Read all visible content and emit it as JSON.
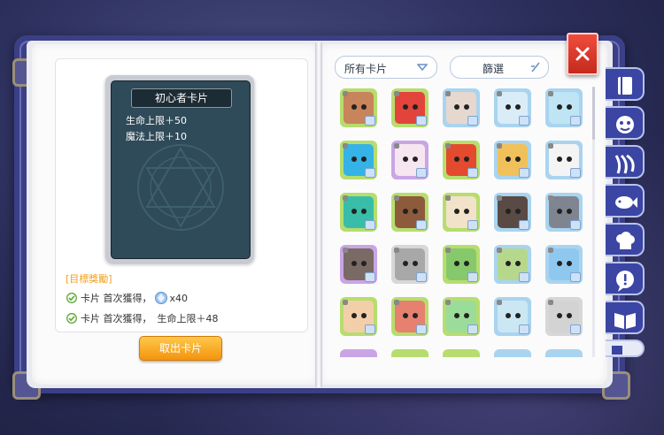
{
  "card": {
    "title": "初心者卡片",
    "stats": [
      "生命上限＋50",
      "魔法上限＋10"
    ]
  },
  "rewards": {
    "title": "[目標獎勵]",
    "items": [
      {
        "prefix": "卡片 首次獲得，",
        "gem_icon": "crystal-icon",
        "suffix": "x40"
      },
      {
        "prefix": "卡片 首次獲得，",
        "suffix": "生命上限＋48"
      }
    ]
  },
  "take_button": "取出卡片",
  "filter": {
    "dropdown_selected": "所有卡片",
    "filter_label": "篩選"
  },
  "colors": {
    "cover": "#3a3f86",
    "accent_orange": "#f3940e",
    "close_red": "#d9362a",
    "frame_green": "#b7dd6e",
    "frame_blue": "#a9d4ef",
    "frame_purple": "#c9a5e6"
  },
  "card_grid": [
    {
      "name": "brown-eye-creature",
      "frame": "#b7dd6e",
      "face": "#c8845a"
    },
    {
      "name": "red-eye-creature",
      "frame": "#b7dd6e",
      "face": "#e2443c"
    },
    {
      "name": "wolf-creature",
      "frame": "#a9d4ef",
      "face": "#e7d8cf"
    },
    {
      "name": "snow-beast",
      "frame": "#a9d4ef",
      "face": "#d9ecf7"
    },
    {
      "name": "frost-beast",
      "frame": "#a9d4ef",
      "face": "#bfe4f4"
    },
    {
      "name": "blue-slime",
      "frame": "#b7dd6e",
      "face": "#35b3e6"
    },
    {
      "name": "pink-ghost",
      "frame": "#c9a5e6",
      "face": "#f6e6ef"
    },
    {
      "name": "red-imp",
      "frame": "#b7dd6e",
      "face": "#e44a2e"
    },
    {
      "name": "flame-knight",
      "frame": "#a9d4ef",
      "face": "#f0c15b"
    },
    {
      "name": "panda",
      "frame": "#a9d4ef",
      "face": "#f4f4f4"
    },
    {
      "name": "sea-dragon",
      "frame": "#b7dd6e",
      "face": "#39bda8"
    },
    {
      "name": "brown-bear",
      "frame": "#b7dd6e",
      "face": "#8d5a3c"
    },
    {
      "name": "white-elf",
      "frame": "#b7dd6e",
      "face": "#f2e2c9"
    },
    {
      "name": "dark-witch",
      "frame": "#a9d4ef",
      "face": "#5a4a46"
    },
    {
      "name": "crow-knight",
      "frame": "#a9d4ef",
      "face": "#7f8590"
    },
    {
      "name": "owl-warrior",
      "frame": "#c9a5e6",
      "face": "#7a6a65"
    },
    {
      "name": "stone-golem",
      "frame": "#d7d7d7",
      "face": "#a8a8a8"
    },
    {
      "name": "leaf-sprite",
      "frame": "#b7dd6e",
      "face": "#86c86c"
    },
    {
      "name": "grass-beast",
      "frame": "#a9d4ef",
      "face": "#b6d88c"
    },
    {
      "name": "ice-dragon",
      "frame": "#a9d4ef",
      "face": "#8fc8ef"
    },
    {
      "name": "praying-hands",
      "frame": "#b7dd6e",
      "face": "#f2cfa8"
    },
    {
      "name": "red-hood",
      "frame": "#b7dd6e",
      "face": "#e6806f"
    },
    {
      "name": "green-fairy",
      "frame": "#b7dd6e",
      "face": "#9bdc9b"
    },
    {
      "name": "sky-angel",
      "frame": "#a9d4ef",
      "face": "#cbe7f3"
    },
    {
      "name": "silver-knight",
      "frame": "#d7d7d7",
      "face": "#d3d3d3"
    }
  ],
  "side_tabs": [
    "book-icon",
    "mask-icon",
    "claw-icon",
    "fish-icon",
    "chef-hat-icon",
    "alert-bubble-icon",
    "open-book-icon"
  ]
}
